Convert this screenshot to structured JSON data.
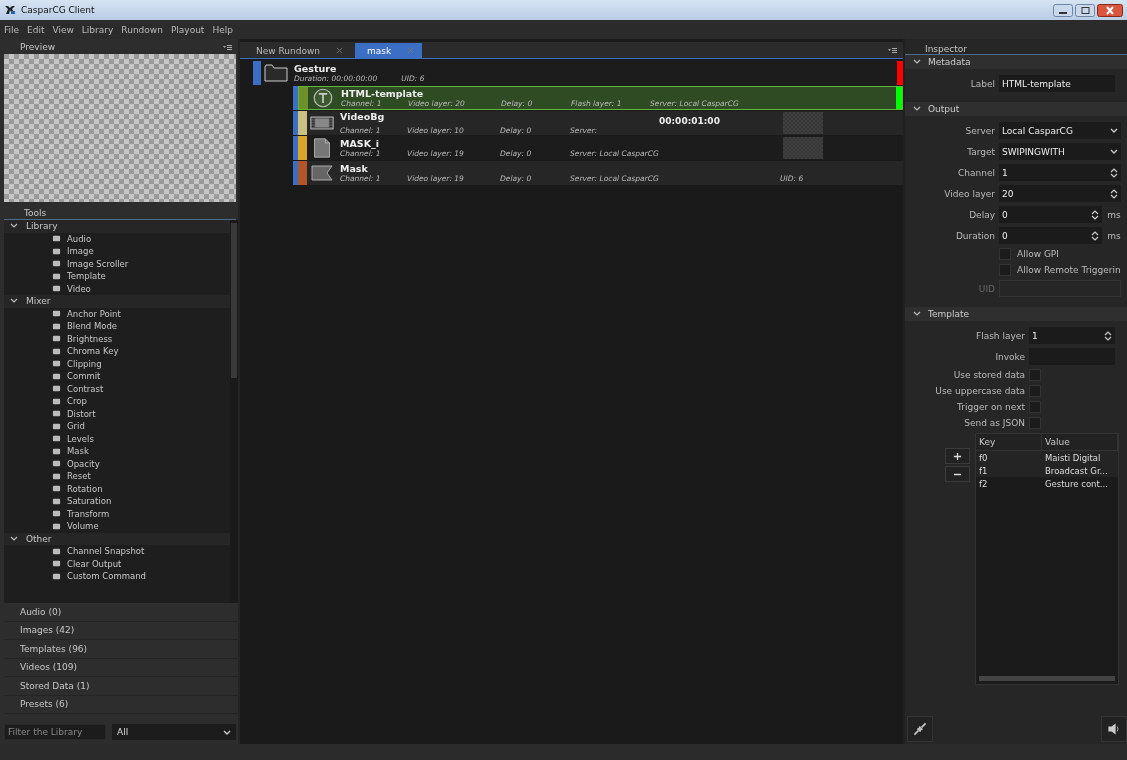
{
  "window": {
    "title": "CasparCG Client"
  },
  "menu": [
    "File",
    "Edit",
    "View",
    "Library",
    "Rundown",
    "Playout",
    "Help"
  ],
  "preview": {
    "title": "Preview"
  },
  "tools": {
    "title": "Tools",
    "groups": [
      {
        "label": "Library",
        "expanded": true,
        "children": [
          {
            "label": "Audio"
          },
          {
            "label": "Image"
          },
          {
            "label": "Image Scroller"
          },
          {
            "label": "Template"
          },
          {
            "label": "Video"
          }
        ]
      },
      {
        "label": "Mixer",
        "expanded": true,
        "children": [
          {
            "label": "Anchor Point"
          },
          {
            "label": "Blend Mode"
          },
          {
            "label": "Brightness"
          },
          {
            "label": "Chroma Key"
          },
          {
            "label": "Clipping"
          },
          {
            "label": "Commit"
          },
          {
            "label": "Contrast"
          },
          {
            "label": "Crop"
          },
          {
            "label": "Distort"
          },
          {
            "label": "Grid"
          },
          {
            "label": "Levels"
          },
          {
            "label": "Mask"
          },
          {
            "label": "Opacity"
          },
          {
            "label": "Reset"
          },
          {
            "label": "Rotation"
          },
          {
            "label": "Saturation"
          },
          {
            "label": "Transform"
          },
          {
            "label": "Volume"
          }
        ]
      },
      {
        "label": "Other",
        "expanded": true,
        "children": [
          {
            "label": "Channel Snapshot"
          },
          {
            "label": "Clear Output"
          },
          {
            "label": "Custom Command"
          }
        ]
      }
    ]
  },
  "library": [
    "Audio (0)",
    "Images (42)",
    "Templates (96)",
    "Videos (109)",
    "Stored Data (1)",
    "Presets (6)"
  ],
  "filter": {
    "placeholder": "Filter the Library",
    "type_value": "All"
  },
  "tabs": [
    {
      "label": "New Rundown",
      "selected": false
    },
    {
      "label": "mask",
      "selected": true
    }
  ],
  "rundown": [
    {
      "kind": "group",
      "name": "Gesture",
      "color": "#3a6fc4",
      "marker": {
        "color": "#ff0000"
      },
      "duration": "Duration: 00:00:00:00",
      "uid": "UID: 6",
      "children": [
        {
          "kind": "template",
          "name": "HTML-template",
          "color": "#6e8f2a",
          "selected": true,
          "marker": {
            "color": "#00ff00"
          },
          "fields": [
            "Channel: 1",
            "Video layer: 20",
            "Delay: 0",
            "Flash layer: 1",
            "Server: Local CasparCG"
          ]
        },
        {
          "kind": "video",
          "name": "VideoBg",
          "color": "#c9c081",
          "selected": false,
          "fields": [
            "Channel: 1",
            "Video layer: 10",
            "Delay: 0",
            "Server:"
          ],
          "timecode": "00:00:01:00",
          "thumbnail": true
        },
        {
          "kind": "image",
          "name": "MASK_i",
          "color": "#d8a52a",
          "selected": false,
          "fields": [
            "Channel: 1",
            "Video layer: 19",
            "Delay: 0",
            "Server: Local CasparCG"
          ],
          "thumbnail": true
        },
        {
          "kind": "mask",
          "name": "Mask",
          "color": "#b0562a",
          "selected": false,
          "fields": [
            "Channel: 1",
            "Video layer: 19",
            "Delay: 0",
            "Server: Local CasparCG"
          ],
          "uid": "UID: 6"
        }
      ]
    }
  ],
  "inspector": {
    "title": "Inspector",
    "sections": [
      {
        "kind": "metadata",
        "title": "Metadata",
        "expanded": true,
        "fields": [
          {
            "kind": "text",
            "label": "Label",
            "value": "HTML-template"
          }
        ]
      },
      {
        "kind": "output",
        "title": "Output",
        "expanded": true,
        "fields": [
          {
            "kind": "select",
            "label": "Server",
            "value": "Local CasparCG"
          },
          {
            "kind": "select",
            "label": "Target",
            "value": "SWIPINGWITH"
          },
          {
            "kind": "spin",
            "label": "Channel",
            "value": "1"
          },
          {
            "kind": "spin",
            "label": "Video layer",
            "value": "20"
          },
          {
            "kind": "spin",
            "label": "Delay",
            "value": "0",
            "unit": "ms"
          },
          {
            "kind": "spin",
            "label": "Duration",
            "value": "0",
            "unit": "ms"
          },
          {
            "kind": "check",
            "label": "Allow GPI",
            "checked": false
          },
          {
            "kind": "check",
            "label": "Allow Remote Triggerin",
            "checked": false
          },
          {
            "kind": "text",
            "label": "UID",
            "disabled": true
          }
        ]
      },
      {
        "kind": "template",
        "title": "Template",
        "expanded": true,
        "fields": [
          {
            "kind": "spin",
            "label": "Flash layer",
            "value": "1"
          },
          {
            "kind": "text",
            "label": "Invoke"
          },
          {
            "kind": "check_left",
            "label": "Use stored data",
            "checked": false
          },
          {
            "kind": "check_left",
            "label": "Use uppercase data",
            "checked": false
          },
          {
            "kind": "check_left",
            "label": "Trigger on next",
            "checked": false
          },
          {
            "kind": "check_left",
            "label": "Send as JSON",
            "checked": false
          }
        ],
        "table": {
          "columns": [
            "Key",
            "Value"
          ],
          "rows": [
            {
              "key": "f0",
              "value": "Maisti Digital"
            },
            {
              "key": "f1",
              "value": "Broadcast Gr..."
            },
            {
              "key": "f2",
              "value": "Gesture cont..."
            }
          ]
        }
      }
    ]
  }
}
